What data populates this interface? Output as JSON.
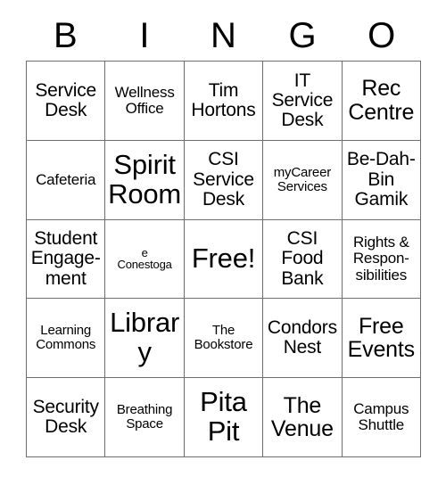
{
  "card": {
    "title": "BINGO Card",
    "header_letters": [
      "B",
      "I",
      "N",
      "G",
      "O"
    ],
    "columns": 5,
    "rows": 5,
    "free_space_index": 12,
    "colors": {
      "background": "#ffffff",
      "text": "#000000",
      "border": "#6e6e6e"
    },
    "cells": [
      {
        "text": "Service\nDesk",
        "size": "lg",
        "name": "cell-service-desk"
      },
      {
        "text": "Wellness\nOffice",
        "size": "md",
        "name": "cell-wellness-office"
      },
      {
        "text": "Tim\nHortons",
        "size": "lg",
        "name": "cell-tim-hortons"
      },
      {
        "text": "IT\nService\nDesk",
        "size": "lg",
        "name": "cell-it-service-desk"
      },
      {
        "text": "Rec\nCentre",
        "size": "xl",
        "name": "cell-rec-centre"
      },
      {
        "text": "Cafeteria",
        "size": "md",
        "name": "cell-cafeteria"
      },
      {
        "text": "Spirit\nRoom",
        "size": "xxl",
        "name": "cell-spirit-room"
      },
      {
        "text": "CSI\nService\nDesk",
        "size": "lg",
        "name": "cell-csi-service-desk"
      },
      {
        "text": "myCareer\nServices",
        "size": "sm",
        "name": "cell-mycareer-services"
      },
      {
        "text": "Be-Dah-\nBin\nGamik",
        "size": "lg",
        "name": "cell-be-dah-bin-gamik"
      },
      {
        "text": "Student\nEngage-\nment",
        "size": "lg",
        "name": "cell-student-engagement"
      },
      {
        "text": "e\nConestoga",
        "size": "xs",
        "name": "cell-e-conestoga"
      },
      {
        "text": "Free!",
        "size": "xxl",
        "name": "cell-free-space"
      },
      {
        "text": "CSI\nFood\nBank",
        "size": "lg",
        "name": "cell-csi-food-bank"
      },
      {
        "text": "Rights &\nRespon-\nsibilities",
        "size": "md",
        "name": "cell-rights-responsibilities"
      },
      {
        "text": "Learning\nCommons",
        "size": "sm",
        "name": "cell-learning-commons"
      },
      {
        "text": "Library",
        "size": "xxl",
        "name": "cell-library"
      },
      {
        "text": "The\nBookstore",
        "size": "sm",
        "name": "cell-the-bookstore"
      },
      {
        "text": "Condors\nNest",
        "size": "lg",
        "name": "cell-condors-nest"
      },
      {
        "text": "Free\nEvents",
        "size": "xl",
        "name": "cell-free-events"
      },
      {
        "text": "Security\nDesk",
        "size": "lg",
        "name": "cell-security-desk"
      },
      {
        "text": "Breathing\nSpace",
        "size": "sm",
        "name": "cell-breathing-space"
      },
      {
        "text": "Pita\nPit",
        "size": "xxl",
        "name": "cell-pita-pit"
      },
      {
        "text": "The\nVenue",
        "size": "xl",
        "name": "cell-the-venue"
      },
      {
        "text": "Campus\nShuttle",
        "size": "md",
        "name": "cell-campus-shuttle"
      }
    ]
  }
}
